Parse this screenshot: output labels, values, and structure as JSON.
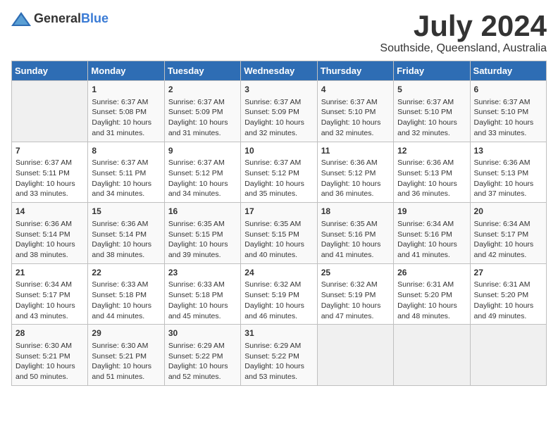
{
  "logo": {
    "general": "General",
    "blue": "Blue"
  },
  "title": {
    "month_year": "July 2024",
    "location": "Southside, Queensland, Australia"
  },
  "days_of_week": [
    "Sunday",
    "Monday",
    "Tuesday",
    "Wednesday",
    "Thursday",
    "Friday",
    "Saturday"
  ],
  "weeks": [
    [
      {
        "day": "",
        "text": ""
      },
      {
        "day": "1",
        "text": "Sunrise: 6:37 AM\nSunset: 5:08 PM\nDaylight: 10 hours\nand 31 minutes."
      },
      {
        "day": "2",
        "text": "Sunrise: 6:37 AM\nSunset: 5:09 PM\nDaylight: 10 hours\nand 31 minutes."
      },
      {
        "day": "3",
        "text": "Sunrise: 6:37 AM\nSunset: 5:09 PM\nDaylight: 10 hours\nand 32 minutes."
      },
      {
        "day": "4",
        "text": "Sunrise: 6:37 AM\nSunset: 5:10 PM\nDaylight: 10 hours\nand 32 minutes."
      },
      {
        "day": "5",
        "text": "Sunrise: 6:37 AM\nSunset: 5:10 PM\nDaylight: 10 hours\nand 32 minutes."
      },
      {
        "day": "6",
        "text": "Sunrise: 6:37 AM\nSunset: 5:10 PM\nDaylight: 10 hours\nand 33 minutes."
      }
    ],
    [
      {
        "day": "7",
        "text": "Sunrise: 6:37 AM\nSunset: 5:11 PM\nDaylight: 10 hours\nand 33 minutes."
      },
      {
        "day": "8",
        "text": "Sunrise: 6:37 AM\nSunset: 5:11 PM\nDaylight: 10 hours\nand 34 minutes."
      },
      {
        "day": "9",
        "text": "Sunrise: 6:37 AM\nSunset: 5:12 PM\nDaylight: 10 hours\nand 34 minutes."
      },
      {
        "day": "10",
        "text": "Sunrise: 6:37 AM\nSunset: 5:12 PM\nDaylight: 10 hours\nand 35 minutes."
      },
      {
        "day": "11",
        "text": "Sunrise: 6:36 AM\nSunset: 5:12 PM\nDaylight: 10 hours\nand 36 minutes."
      },
      {
        "day": "12",
        "text": "Sunrise: 6:36 AM\nSunset: 5:13 PM\nDaylight: 10 hours\nand 36 minutes."
      },
      {
        "day": "13",
        "text": "Sunrise: 6:36 AM\nSunset: 5:13 PM\nDaylight: 10 hours\nand 37 minutes."
      }
    ],
    [
      {
        "day": "14",
        "text": "Sunrise: 6:36 AM\nSunset: 5:14 PM\nDaylight: 10 hours\nand 38 minutes."
      },
      {
        "day": "15",
        "text": "Sunrise: 6:36 AM\nSunset: 5:14 PM\nDaylight: 10 hours\nand 38 minutes."
      },
      {
        "day": "16",
        "text": "Sunrise: 6:35 AM\nSunset: 5:15 PM\nDaylight: 10 hours\nand 39 minutes."
      },
      {
        "day": "17",
        "text": "Sunrise: 6:35 AM\nSunset: 5:15 PM\nDaylight: 10 hours\nand 40 minutes."
      },
      {
        "day": "18",
        "text": "Sunrise: 6:35 AM\nSunset: 5:16 PM\nDaylight: 10 hours\nand 41 minutes."
      },
      {
        "day": "19",
        "text": "Sunrise: 6:34 AM\nSunset: 5:16 PM\nDaylight: 10 hours\nand 41 minutes."
      },
      {
        "day": "20",
        "text": "Sunrise: 6:34 AM\nSunset: 5:17 PM\nDaylight: 10 hours\nand 42 minutes."
      }
    ],
    [
      {
        "day": "21",
        "text": "Sunrise: 6:34 AM\nSunset: 5:17 PM\nDaylight: 10 hours\nand 43 minutes."
      },
      {
        "day": "22",
        "text": "Sunrise: 6:33 AM\nSunset: 5:18 PM\nDaylight: 10 hours\nand 44 minutes."
      },
      {
        "day": "23",
        "text": "Sunrise: 6:33 AM\nSunset: 5:18 PM\nDaylight: 10 hours\nand 45 minutes."
      },
      {
        "day": "24",
        "text": "Sunrise: 6:32 AM\nSunset: 5:19 PM\nDaylight: 10 hours\nand 46 minutes."
      },
      {
        "day": "25",
        "text": "Sunrise: 6:32 AM\nSunset: 5:19 PM\nDaylight: 10 hours\nand 47 minutes."
      },
      {
        "day": "26",
        "text": "Sunrise: 6:31 AM\nSunset: 5:20 PM\nDaylight: 10 hours\nand 48 minutes."
      },
      {
        "day": "27",
        "text": "Sunrise: 6:31 AM\nSunset: 5:20 PM\nDaylight: 10 hours\nand 49 minutes."
      }
    ],
    [
      {
        "day": "28",
        "text": "Sunrise: 6:30 AM\nSunset: 5:21 PM\nDaylight: 10 hours\nand 50 minutes."
      },
      {
        "day": "29",
        "text": "Sunrise: 6:30 AM\nSunset: 5:21 PM\nDaylight: 10 hours\nand 51 minutes."
      },
      {
        "day": "30",
        "text": "Sunrise: 6:29 AM\nSunset: 5:22 PM\nDaylight: 10 hours\nand 52 minutes."
      },
      {
        "day": "31",
        "text": "Sunrise: 6:29 AM\nSunset: 5:22 PM\nDaylight: 10 hours\nand 53 minutes."
      },
      {
        "day": "",
        "text": ""
      },
      {
        "day": "",
        "text": ""
      },
      {
        "day": "",
        "text": ""
      }
    ]
  ]
}
